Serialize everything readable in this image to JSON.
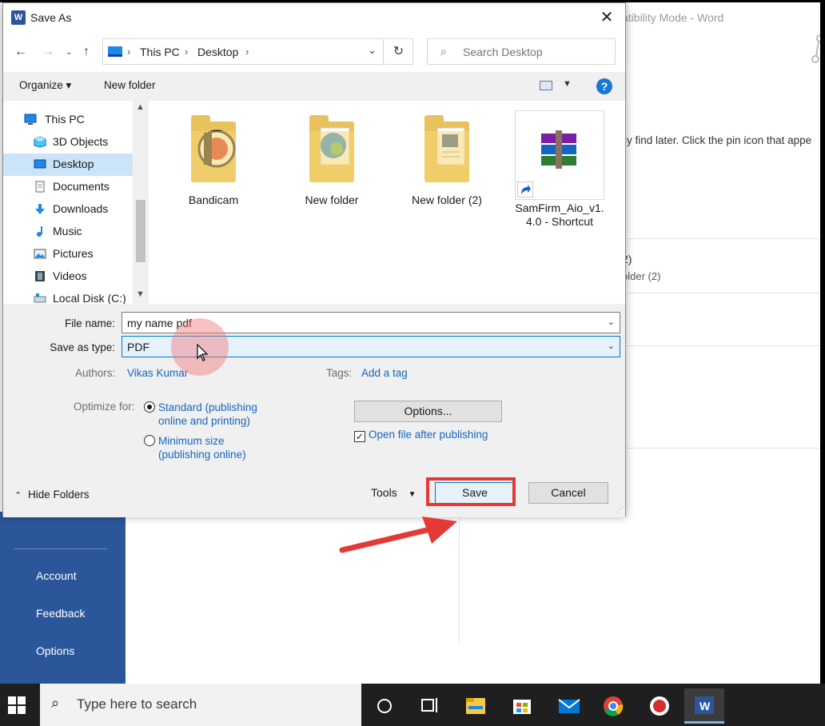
{
  "word_bg": {
    "title_fragment": "atibility Mode  -  Word",
    "hint_fragment": "ily find later. Click the pin icon that appe",
    "item_fragment_a": "2)",
    "item_fragment_b": "older (2)",
    "nav": [
      "Account",
      "Feedback",
      "Options"
    ],
    "accent": "#2b579a"
  },
  "dialog": {
    "title": "Save As",
    "close_glyph": "✕",
    "breadcrumb": [
      "This PC",
      "Desktop"
    ],
    "search_placeholder": "Search Desktop",
    "toolbar": {
      "organize": "Organize",
      "new_folder": "New folder"
    },
    "sidebar": [
      {
        "label": "This PC",
        "icon": "computer-icon"
      },
      {
        "label": "3D Objects",
        "icon": "cube-icon"
      },
      {
        "label": "Desktop",
        "icon": "desktop-icon",
        "selected": true
      },
      {
        "label": "Documents",
        "icon": "document-icon"
      },
      {
        "label": "Downloads",
        "icon": "download-arrow-icon"
      },
      {
        "label": "Music",
        "icon": "music-note-icon"
      },
      {
        "label": "Pictures",
        "icon": "picture-icon"
      },
      {
        "label": "Videos",
        "icon": "film-icon"
      },
      {
        "label": "Local Disk (C:)",
        "icon": "drive-icon"
      }
    ],
    "files": [
      {
        "name": "Bandicam",
        "icon": "bandicam-folder-icon"
      },
      {
        "name": "New folder",
        "icon": "edge-folder-icon"
      },
      {
        "name": "New folder (2)",
        "icon": "word-doc-folder-icon"
      },
      {
        "name": "SamFirm_Aio_v1.\n4.0 - Shortcut",
        "icon": "winrar-shortcut-icon"
      }
    ],
    "filename_label": "File name:",
    "filename_value": "my name pdf",
    "type_label": "Save as type:",
    "type_value": "PDF",
    "authors_label": "Authors:",
    "authors_value": "Vikas Kumar",
    "tags_label": "Tags:",
    "tags_value": "Add a tag",
    "optimize_label": "Optimize for:",
    "optimize_options": [
      {
        "label": "Standard (publishing\nonline and printing)",
        "checked": true
      },
      {
        "label": "Minimum size\n(publishing online)",
        "checked": false
      }
    ],
    "options_button": "Options...",
    "open_after_label": "Open file after publishing",
    "open_after_checked": true,
    "hide_folders": "Hide Folders",
    "tools": "Tools",
    "save": "Save",
    "cancel": "Cancel",
    "highlight_color": "#e53935"
  },
  "taskbar": {
    "search_placeholder": "Type here to search"
  }
}
